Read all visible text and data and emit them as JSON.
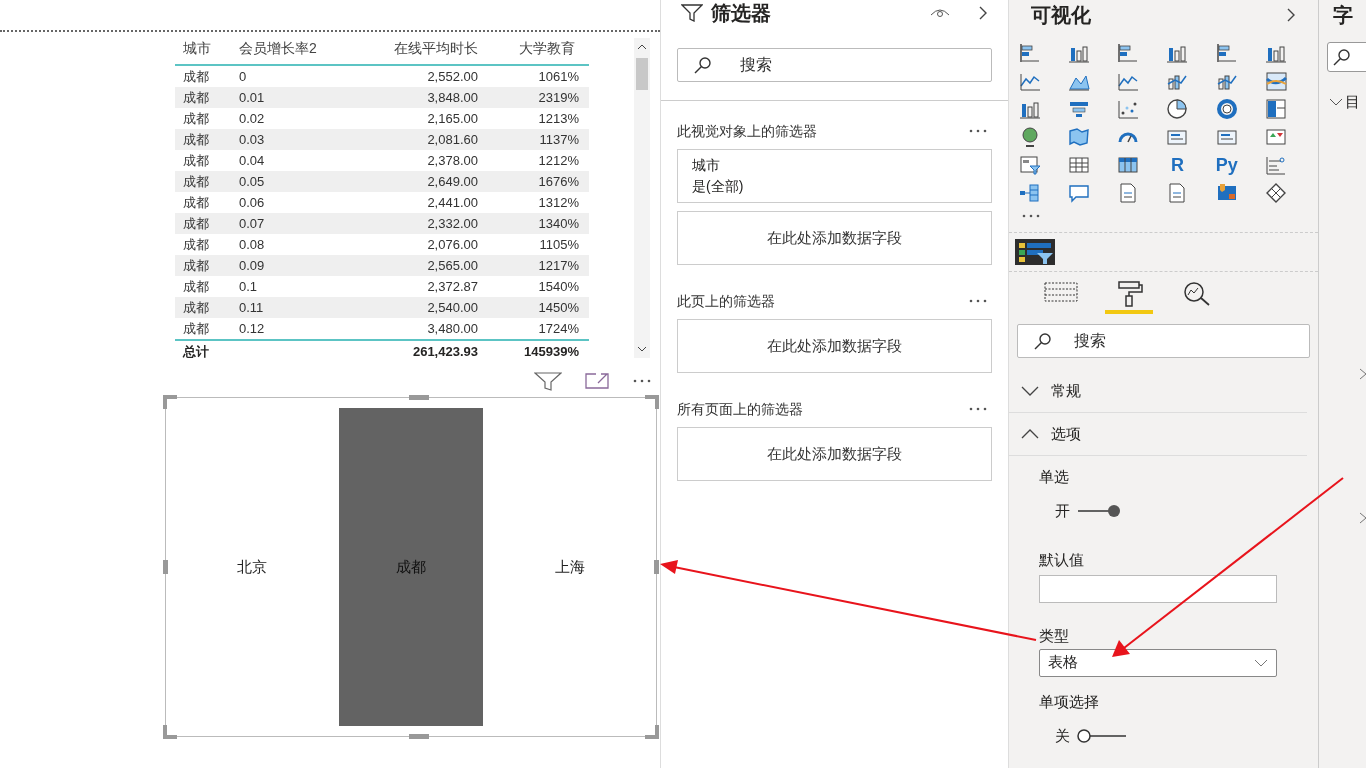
{
  "table": {
    "columns": [
      "城市",
      "会员增长率2",
      "在线平均时长",
      "大学教育"
    ],
    "rows": [
      [
        "成都",
        "0",
        "2,552.00",
        "1061%"
      ],
      [
        "成都",
        "0.01",
        "3,848.00",
        "2319%"
      ],
      [
        "成都",
        "0.02",
        "2,165.00",
        "1213%"
      ],
      [
        "成都",
        "0.03",
        "2,081.60",
        "1137%"
      ],
      [
        "成都",
        "0.04",
        "2,378.00",
        "1212%"
      ],
      [
        "成都",
        "0.05",
        "2,649.00",
        "1676%"
      ],
      [
        "成都",
        "0.06",
        "2,441.00",
        "1312%"
      ],
      [
        "成都",
        "0.07",
        "2,332.00",
        "1340%"
      ],
      [
        "成都",
        "0.08",
        "2,076.00",
        "1105%"
      ],
      [
        "成都",
        "0.09",
        "2,565.00",
        "1217%"
      ],
      [
        "成都",
        "0.1",
        "2,372.87",
        "1540%"
      ],
      [
        "成都",
        "0.11",
        "2,540.00",
        "1450%"
      ],
      [
        "成都",
        "0.12",
        "3,480.00",
        "1724%"
      ]
    ],
    "total": {
      "label": "总计",
      "values": [
        "261,423.93",
        "145939%"
      ]
    }
  },
  "slicer": {
    "items": [
      {
        "label": "北京",
        "selected": false
      },
      {
        "label": "成都",
        "selected": true
      },
      {
        "label": "上海",
        "selected": false
      }
    ]
  },
  "filters": {
    "title": "筛选器",
    "search": {
      "placeholder": "搜索"
    },
    "sections": [
      {
        "title": "此视觉对象上的筛选器",
        "cards": [
          {
            "field": "城市",
            "value": "是(全部)"
          }
        ],
        "add_label": "在此处添加数据字段"
      },
      {
        "title": "此页上的筛选器",
        "add_label": "在此处添加数据字段"
      },
      {
        "title": "所有页面上的筛选器",
        "add_label": "在此处添加数据字段"
      }
    ]
  },
  "visualizations": {
    "title": "可视化",
    "text_icons": [
      "R",
      "Py"
    ],
    "format_tabs": [
      {
        "selected": false
      },
      {
        "selected": true
      },
      {
        "selected": false
      }
    ],
    "search": {
      "placeholder": "搜索"
    },
    "sections": [
      {
        "title": "常规",
        "expanded": false
      },
      {
        "title": "选项",
        "expanded": true
      }
    ],
    "options": [
      {
        "kind": "toggle",
        "label": "单选",
        "state_label": "开",
        "on": true
      },
      {
        "kind": "input",
        "label": "默认值"
      },
      {
        "kind": "dropdown",
        "label": "类型",
        "value": "表格"
      },
      {
        "kind": "toggle",
        "label": "单项选择",
        "state_label": "关",
        "on": false
      }
    ]
  },
  "fields": {
    "title": "字",
    "item": "目"
  }
}
